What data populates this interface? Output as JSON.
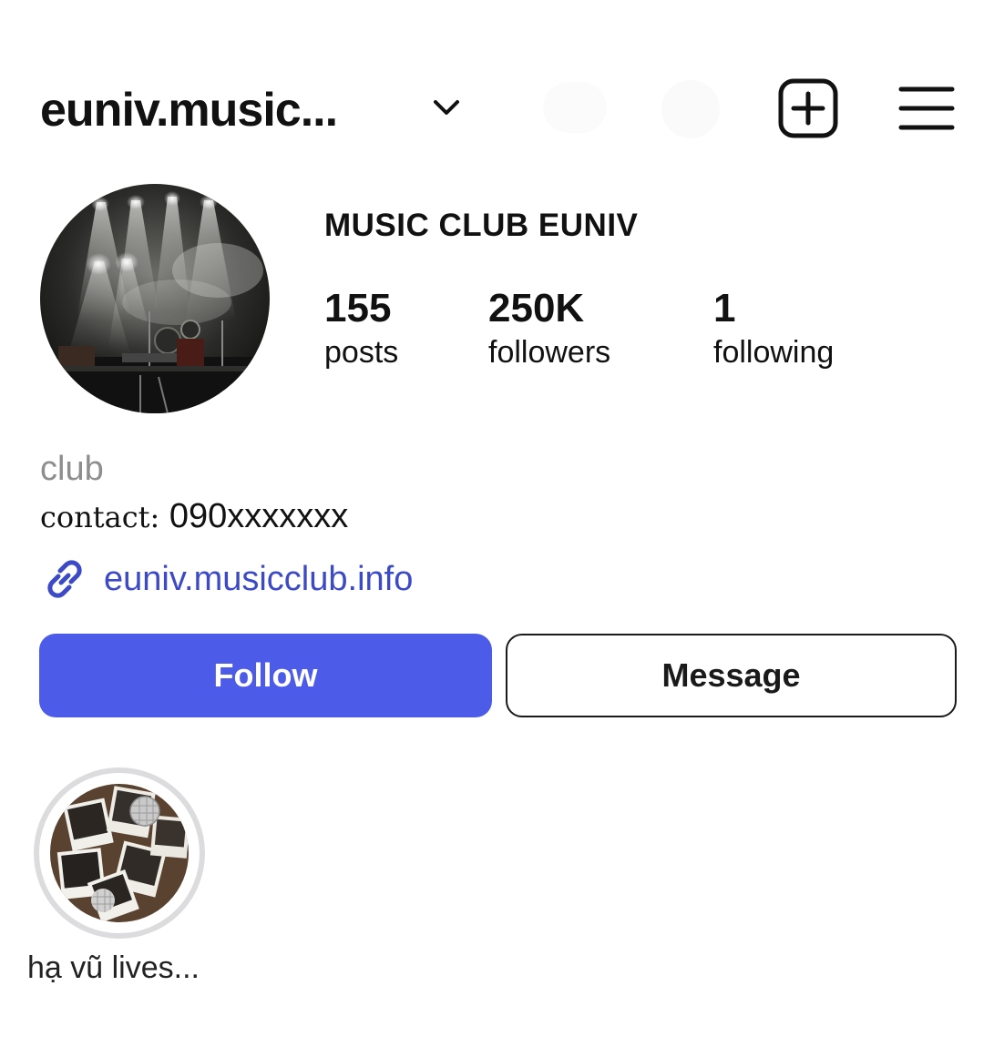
{
  "header": {
    "username": "euniv.music...",
    "icons": [
      "chevron-down-icon",
      "new-post-icon",
      "menu-icon"
    ]
  },
  "profile": {
    "display_name": "MUSIC CLUB EUNIV",
    "stats": [
      {
        "value": "155",
        "label": "posts"
      },
      {
        "value": "250K",
        "label": "followers"
      },
      {
        "value": "1",
        "label": "following"
      }
    ],
    "category": "club",
    "contact_label": "contact:",
    "contact_value": " 090xxxxxxx",
    "link": "euniv.musicclub.info"
  },
  "actions": {
    "follow_label": "Follow",
    "message_label": "Message"
  },
  "highlights": [
    {
      "label": "hạ vũ lives..."
    }
  ],
  "colors": {
    "follow_button": "#4c5be8",
    "link": "#3d4ac6",
    "category_text": "#8e8e8e",
    "highlight_ring": "#dcdcdf"
  }
}
